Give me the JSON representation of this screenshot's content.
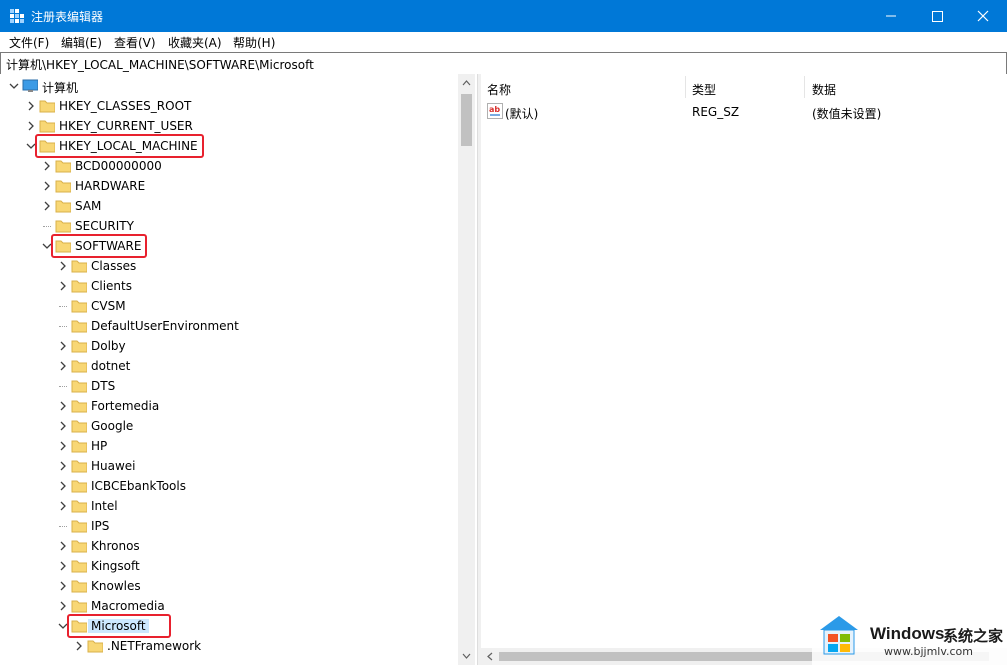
{
  "window": {
    "title": "注册表编辑器"
  },
  "menu": [
    {
      "label": "文件(F)"
    },
    {
      "label": "编辑(E)"
    },
    {
      "label": "查看(V)"
    },
    {
      "label": "收藏夹(A)"
    },
    {
      "label": "帮助(H)"
    }
  ],
  "address": {
    "path": "计算机\\HKEY_LOCAL_MACHINE\\SOFTWARE\\Microsoft"
  },
  "tree": [
    {
      "label": "计算机",
      "expander": "open"
    },
    {
      "label": "HKEY_CLASSES_ROOT",
      "expander": "closed"
    },
    {
      "label": "HKEY_CURRENT_USER",
      "expander": "closed"
    },
    {
      "label": "HKEY_LOCAL_MACHINE",
      "expander": "open",
      "highlighted": true
    },
    {
      "label": "BCD00000000",
      "expander": "closed"
    },
    {
      "label": "HARDWARE",
      "expander": "closed"
    },
    {
      "label": "SAM",
      "expander": "closed"
    },
    {
      "label": "SECURITY",
      "expander": "none"
    },
    {
      "label": "SOFTWARE",
      "expander": "open",
      "highlighted": true
    },
    {
      "label": "Classes",
      "expander": "closed"
    },
    {
      "label": "Clients",
      "expander": "closed"
    },
    {
      "label": "CVSM",
      "expander": "none"
    },
    {
      "label": "DefaultUserEnvironment",
      "expander": "none"
    },
    {
      "label": "Dolby",
      "expander": "closed"
    },
    {
      "label": "dotnet",
      "expander": "closed"
    },
    {
      "label": "DTS",
      "expander": "none"
    },
    {
      "label": "Fortemedia",
      "expander": "closed"
    },
    {
      "label": "Google",
      "expander": "closed"
    },
    {
      "label": "HP",
      "expander": "closed"
    },
    {
      "label": "Huawei",
      "expander": "closed"
    },
    {
      "label": "ICBCEbankTools",
      "expander": "closed"
    },
    {
      "label": "Intel",
      "expander": "closed"
    },
    {
      "label": "IPS",
      "expander": "none"
    },
    {
      "label": "Khronos",
      "expander": "closed"
    },
    {
      "label": "Kingsoft",
      "expander": "closed"
    },
    {
      "label": "Knowles",
      "expander": "closed"
    },
    {
      "label": "Macromedia",
      "expander": "closed"
    },
    {
      "label": "Microsoft",
      "expander": "open",
      "highlighted": true,
      "selected": true
    },
    {
      "label": ".NETFramework",
      "expander": "closed"
    }
  ],
  "columns": [
    {
      "label": "名称"
    },
    {
      "label": "类型"
    },
    {
      "label": "数据"
    }
  ],
  "values": [
    {
      "name": "(默认)",
      "type": "REG_SZ",
      "data": "(数值未设置)"
    }
  ],
  "watermark": {
    "brand": "Windows",
    "suffix": "系统之家",
    "url": "www.bjjmlv.com"
  },
  "colors": {
    "titlebar": "#0078d7",
    "highlight": "#e8212e",
    "selection": "#cce8ff",
    "folder": "#f8d775"
  }
}
